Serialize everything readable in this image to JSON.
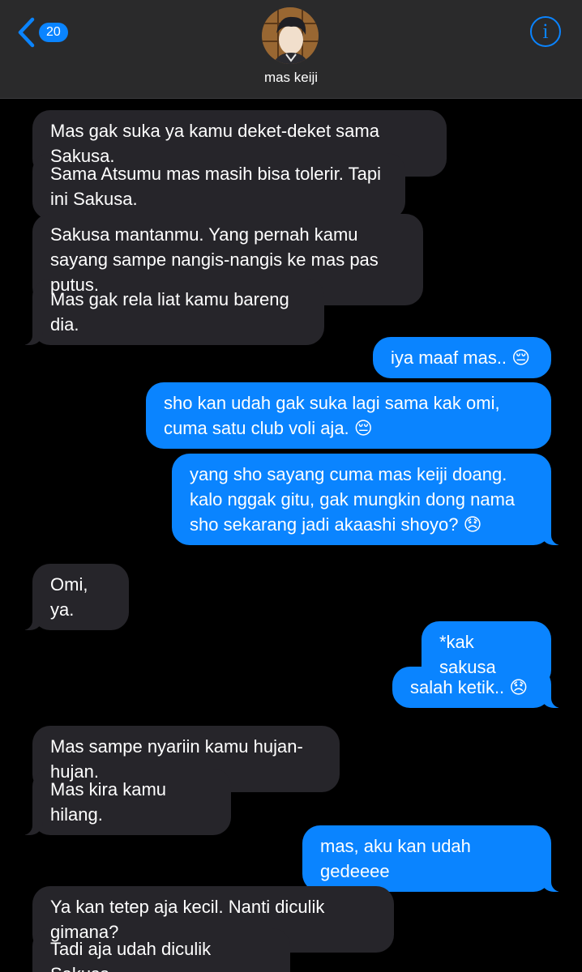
{
  "header": {
    "back_badge": "20",
    "contact_name": "mas keiji",
    "info_label": "i"
  },
  "colors": {
    "sent_bubble": "#0a84ff",
    "received_bubble": "#26252a",
    "background": "#000000",
    "header_bg": "#2a2a2b"
  },
  "messages": [
    {
      "from": "them",
      "text": "Mas gak suka ya kamu deket-deket sama Sakusa."
    },
    {
      "from": "them",
      "text": "Sama Atsumu mas masih bisa tolerir. Tapi ini Sakusa."
    },
    {
      "from": "them",
      "text": "Sakusa mantanmu. Yang pernah kamu sayang sampe nangis-nangis ke mas pas putus."
    },
    {
      "from": "them",
      "text": "Mas gak rela liat kamu bareng dia."
    },
    {
      "from": "me",
      "text": "iya maaf mas.. 😔"
    },
    {
      "from": "me",
      "text": "sho kan udah gak suka lagi sama kak omi, cuma satu club voli aja. 😔"
    },
    {
      "from": "me",
      "text": "yang sho sayang cuma mas keiji doang. kalo nggak gitu, gak mungkin dong nama sho sekarang jadi akaashi shoyo? 😞"
    },
    {
      "from": "them",
      "text": "Omi, ya."
    },
    {
      "from": "me",
      "text": "*kak sakusa"
    },
    {
      "from": "me",
      "text": "salah ketik.. 😞"
    },
    {
      "from": "them",
      "text": "Mas sampe nyariin kamu hujan-hujan."
    },
    {
      "from": "them",
      "text": "Mas kira kamu hilang."
    },
    {
      "from": "me",
      "text": "mas, aku kan udah gedeeee"
    },
    {
      "from": "them",
      "text": "Ya kan tetep aja kecil. Nanti diculik gimana?"
    },
    {
      "from": "them",
      "text": "Tadi aja udah diculik Sakusa."
    }
  ]
}
